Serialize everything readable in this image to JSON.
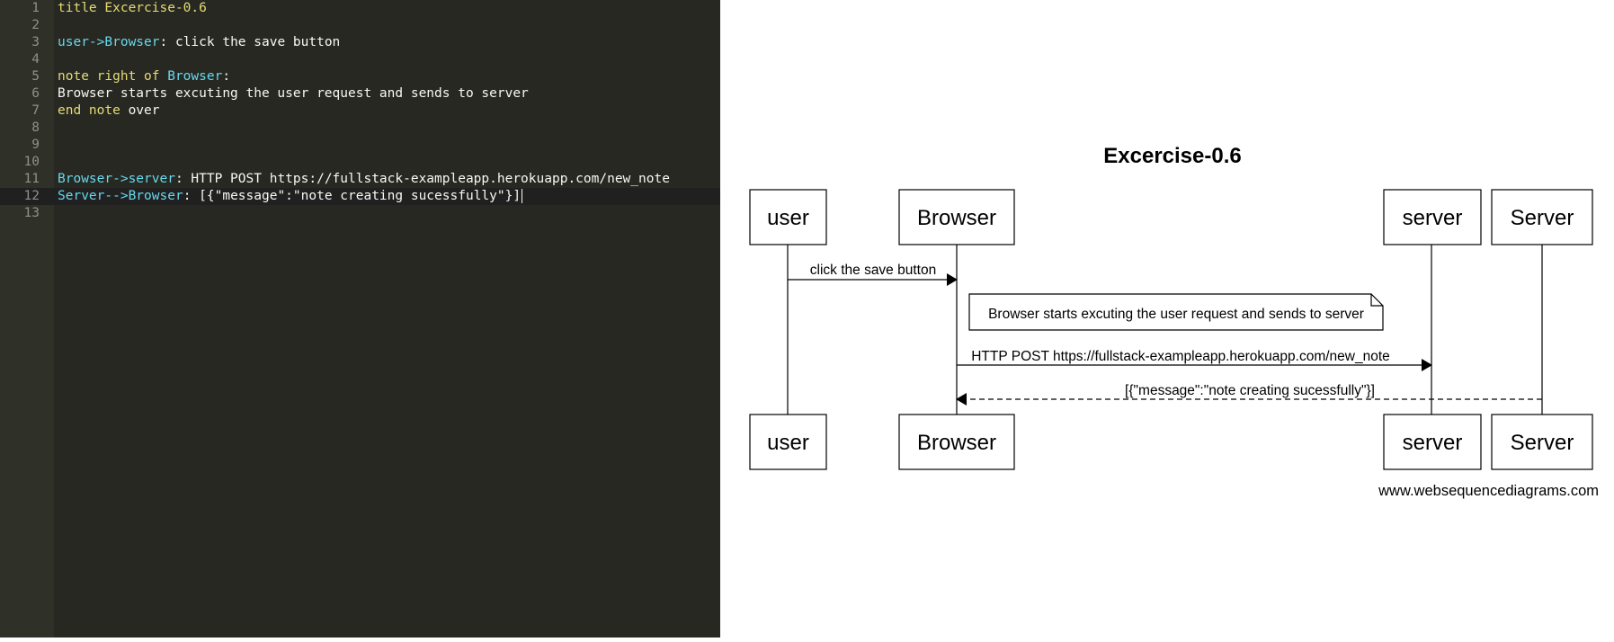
{
  "editor": {
    "lines": [
      {
        "n": "1",
        "tokens": [
          {
            "t": "title",
            "c": "kw"
          },
          {
            "t": " Excercise-0.6",
            "c": "kw"
          }
        ]
      },
      {
        "n": "2",
        "tokens": []
      },
      {
        "n": "3",
        "tokens": [
          {
            "t": "user->Browser",
            "c": "id"
          },
          {
            "t": ": click the save button",
            "c": ""
          }
        ]
      },
      {
        "n": "4",
        "tokens": []
      },
      {
        "n": "5",
        "tokens": [
          {
            "t": "note right of ",
            "c": "kw"
          },
          {
            "t": "Browser",
            "c": "id"
          },
          {
            "t": ":",
            "c": ""
          }
        ]
      },
      {
        "n": "6",
        "tokens": [
          {
            "t": "Browser starts excuting the user request and sends to server",
            "c": ""
          }
        ]
      },
      {
        "n": "7",
        "tokens": [
          {
            "t": "end note",
            "c": "kw"
          },
          {
            "t": " over",
            "c": ""
          }
        ]
      },
      {
        "n": "8",
        "tokens": []
      },
      {
        "n": "9",
        "tokens": []
      },
      {
        "n": "10",
        "tokens": []
      },
      {
        "n": "11",
        "tokens": [
          {
            "t": "Browser->server",
            "c": "id"
          },
          {
            "t": ": HTTP POST https://fullstack-exampleapp.herokuapp.com/new_note",
            "c": ""
          }
        ]
      },
      {
        "n": "12",
        "tokens": [
          {
            "t": "Server-->Browser",
            "c": "id"
          },
          {
            "t": ": [{\"message\":\"note creating sucessfully\"}]",
            "c": ""
          }
        ]
      },
      {
        "n": "13",
        "tokens": []
      }
    ],
    "active_line": "12"
  },
  "diagram": {
    "title": "Excercise-0.6",
    "participants": [
      "user",
      "Browser",
      "server",
      "Server"
    ],
    "messages": [
      {
        "from": "user",
        "to": "Browser",
        "label": "click the save button",
        "style": "solid"
      },
      {
        "from": "Browser",
        "to": "server",
        "label": "HTTP POST https://fullstack-exampleapp.herokuapp.com/new_note",
        "style": "solid"
      },
      {
        "from": "Server",
        "to": "Browser",
        "label": "[{\"message\":\"note creating sucessfully\"}]",
        "style": "dashed"
      }
    ],
    "note": "Browser starts excuting the user request and sends to server",
    "watermark": "www.websequencediagrams.com"
  }
}
